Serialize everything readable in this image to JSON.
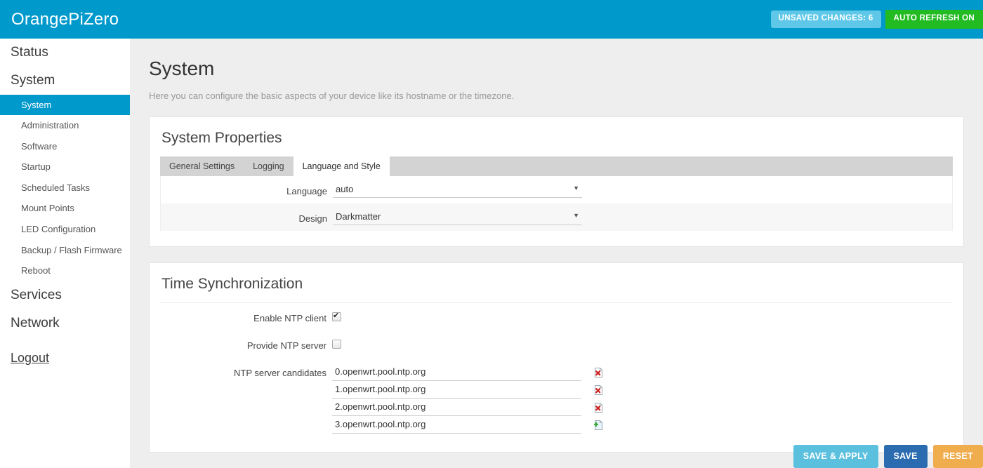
{
  "header": {
    "brand": "OrangePiZero",
    "unsaved_changes_label": "UNSAVED CHANGES: 6",
    "auto_refresh_label": "AUTO REFRESH ON",
    "bar_color": "#0099cc",
    "unsaved_color": "#5fc8e8",
    "auto_refresh_color": "#22bb22"
  },
  "sidebar": {
    "items": [
      {
        "label": "Status",
        "level": "top"
      },
      {
        "label": "System",
        "level": "top"
      },
      {
        "label": "System",
        "level": "sub",
        "active": true
      },
      {
        "label": "Administration",
        "level": "sub",
        "active": false
      },
      {
        "label": "Software",
        "level": "sub",
        "active": false
      },
      {
        "label": "Startup",
        "level": "sub",
        "active": false
      },
      {
        "label": "Scheduled Tasks",
        "level": "sub",
        "active": false
      },
      {
        "label": "Mount Points",
        "level": "sub",
        "active": false
      },
      {
        "label": "LED Configuration",
        "level": "sub",
        "active": false
      },
      {
        "label": "Backup / Flash Firmware",
        "level": "sub",
        "active": false
      },
      {
        "label": "Reboot",
        "level": "sub",
        "active": false
      },
      {
        "label": "Services",
        "level": "top"
      },
      {
        "label": "Network",
        "level": "top"
      }
    ],
    "logout_label": "Logout",
    "active_color": "#0099cc"
  },
  "page": {
    "title": "System",
    "description": "Here you can configure the basic aspects of your device like its hostname or the timezone."
  },
  "system_properties": {
    "title": "System Properties",
    "tabs": [
      {
        "label": "General Settings",
        "active": false
      },
      {
        "label": "Logging",
        "active": false
      },
      {
        "label": "Language and Style",
        "active": true
      }
    ],
    "fields": [
      {
        "label": "Language",
        "value": "auto",
        "caret": "▼"
      },
      {
        "label": "Design",
        "value": "Darkmatter",
        "caret": "▼"
      }
    ]
  },
  "time_sync": {
    "title": "Time Synchronization",
    "enable_ntp_client": {
      "label": "Enable NTP client",
      "checked": true
    },
    "provide_ntp_server": {
      "label": "Provide NTP server",
      "checked": false
    },
    "ntp_candidates": {
      "label": "NTP server candidates",
      "entries": [
        {
          "value": "0.openwrt.pool.ntp.org",
          "action": "remove-icon"
        },
        {
          "value": "1.openwrt.pool.ntp.org",
          "action": "remove-icon"
        },
        {
          "value": "2.openwrt.pool.ntp.org",
          "action": "remove-icon"
        },
        {
          "value": "3.openwrt.pool.ntp.org",
          "action": "add-icon"
        }
      ]
    }
  },
  "footer": {
    "save_apply_label": "SAVE & APPLY",
    "save_label": "SAVE",
    "reset_label": "RESET",
    "save_apply_color": "#5bc0de",
    "save_color": "#2b6cb0",
    "reset_color": "#f0ad4e"
  }
}
